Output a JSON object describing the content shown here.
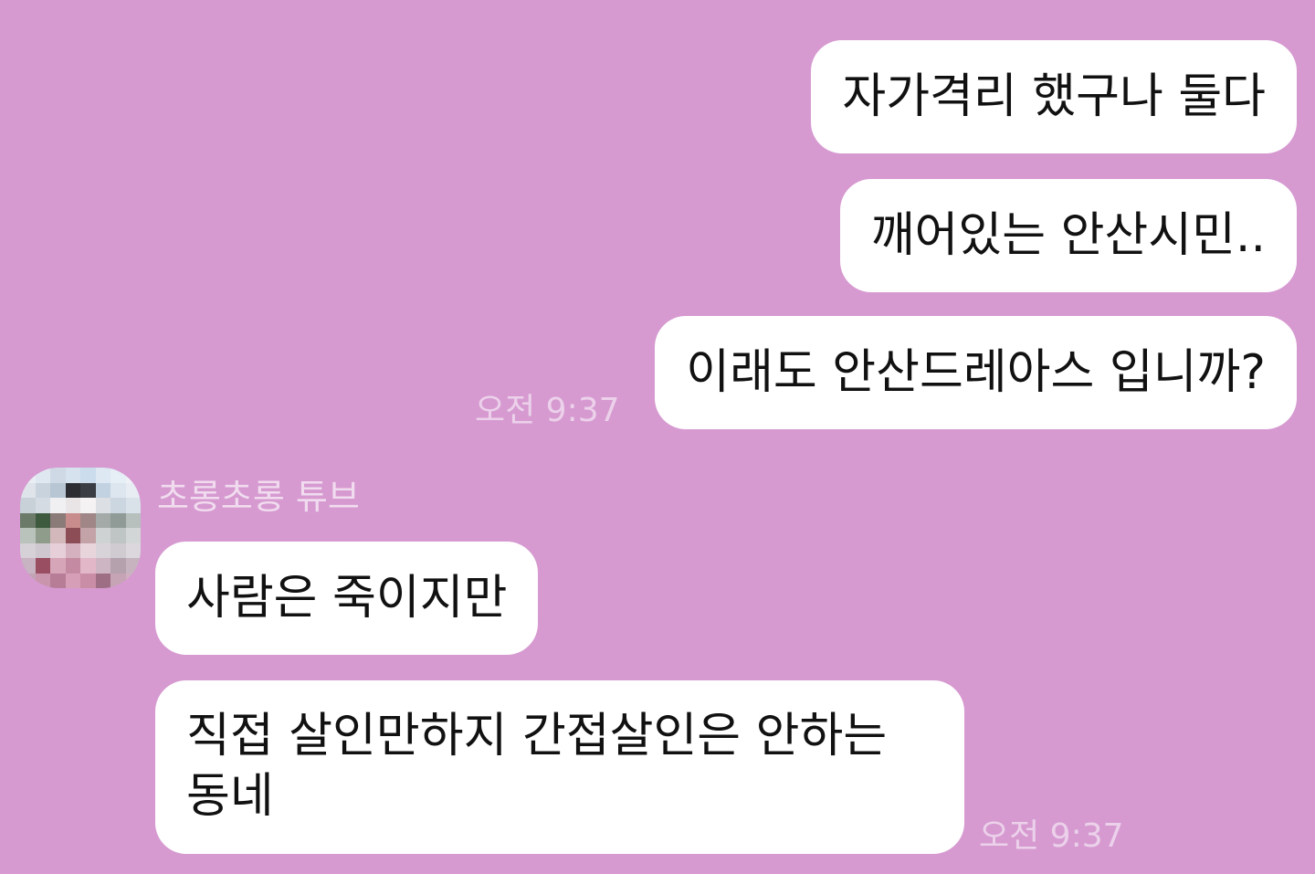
{
  "outgoing": [
    {
      "text": "자가격리 했구나 둘다"
    },
    {
      "text": "깨어있는 안산시민.."
    },
    {
      "text": "이래도 안산드레아스 입니까?"
    }
  ],
  "outgoing_time": "오전 9:37",
  "sender": {
    "name": "초롱초롱 튜브",
    "avatar_icon": "pixelated-avatar"
  },
  "incoming": [
    {
      "text": "사람은 죽이지만"
    },
    {
      "line1": "직접 살인만하지 간접살인은 안하는",
      "line2": "동네"
    }
  ],
  "incoming_time": "오전 9:37",
  "colors": {
    "background": "#d69ad1",
    "bubble": "#ffffff",
    "timestamp": "#ecd1ea"
  }
}
